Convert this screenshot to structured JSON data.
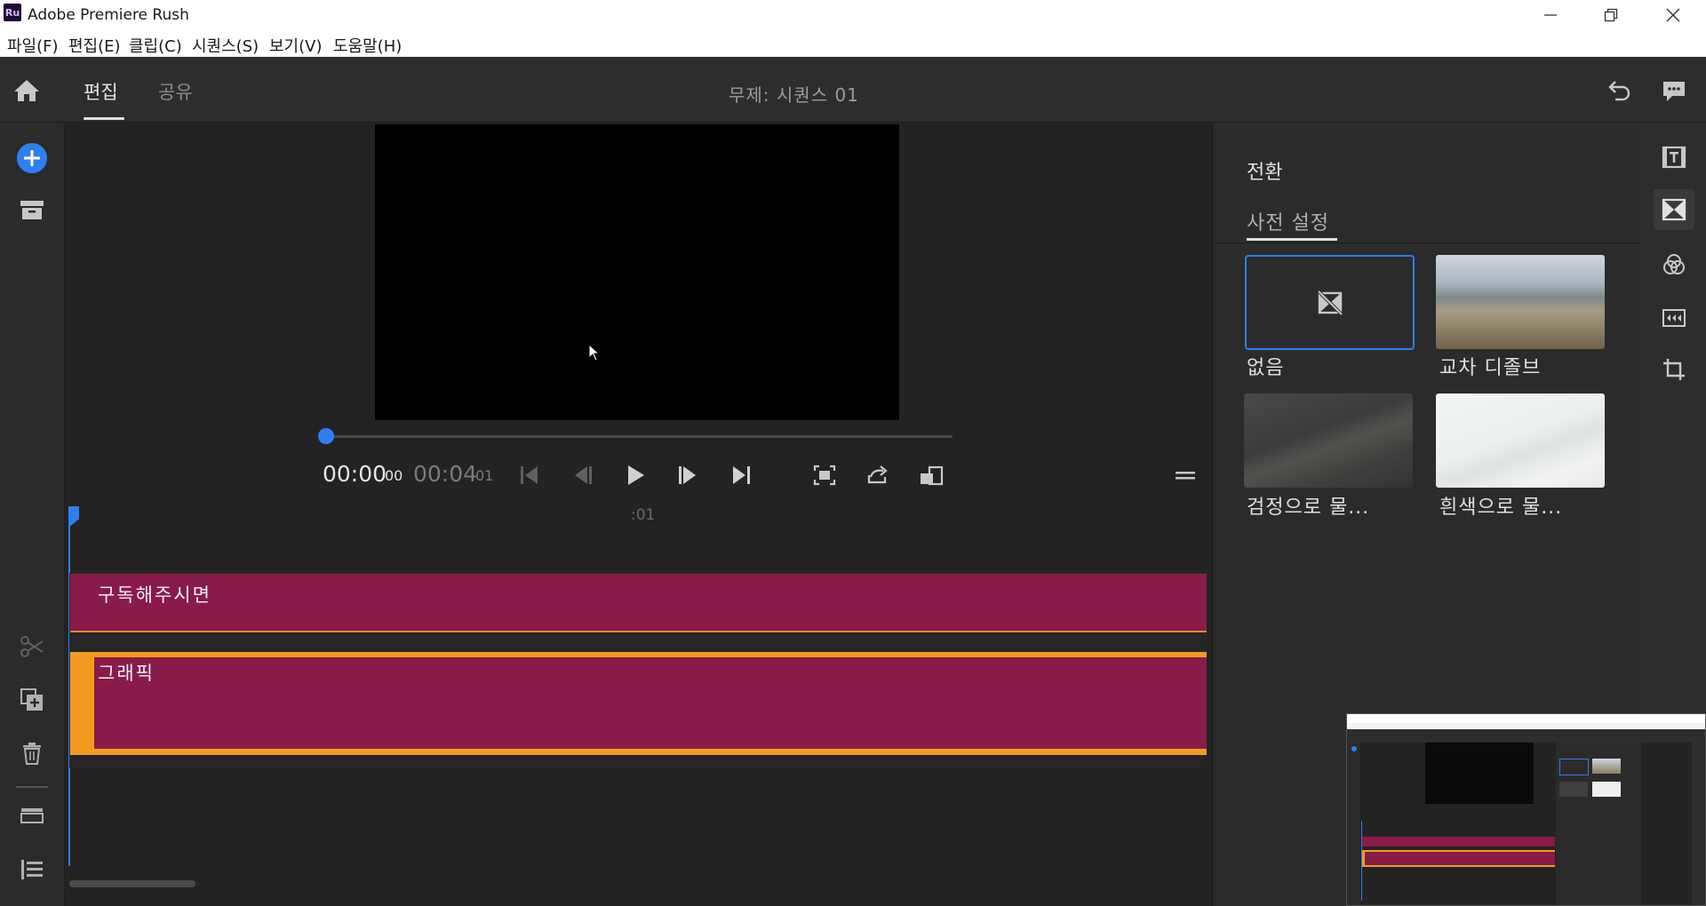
{
  "window": {
    "app_logo": "Ru",
    "title": "Adobe Premiere Rush",
    "controls": [
      "minimize-icon",
      "restore-icon",
      "close-icon"
    ]
  },
  "menu": {
    "items": [
      "파일(F)",
      "편집(E)",
      "클립(C)",
      "시퀀스(S)",
      "보기(V)",
      "도움말(H)"
    ]
  },
  "header": {
    "tabs": [
      {
        "label": "편집",
        "active": true
      },
      {
        "label": "공유",
        "active": false
      }
    ],
    "sequence_title": "무제: 시퀀스 01"
  },
  "player": {
    "current_time": "00:00",
    "current_frames": "00",
    "total_time": "00:04",
    "total_frames": "01",
    "progress": 0
  },
  "timeline": {
    "ruler_label": ":01",
    "clips": [
      {
        "label": "구독해주시면",
        "color": "#881b49"
      },
      {
        "label": "그래픽",
        "color": "#881b49",
        "selected": true
      }
    ],
    "selection_color": "#f39b21"
  },
  "panel": {
    "title": "전환",
    "tab": "사전 설정",
    "presets": [
      {
        "label": "없음",
        "selected": true
      },
      {
        "label": "교차 디졸브"
      },
      {
        "label": "검정으로 물..."
      },
      {
        "label": "흰색으로 물..."
      }
    ]
  },
  "colors": {
    "accent": "#2d80f2",
    "clip": "#881b49",
    "selection": "#f39b21"
  }
}
